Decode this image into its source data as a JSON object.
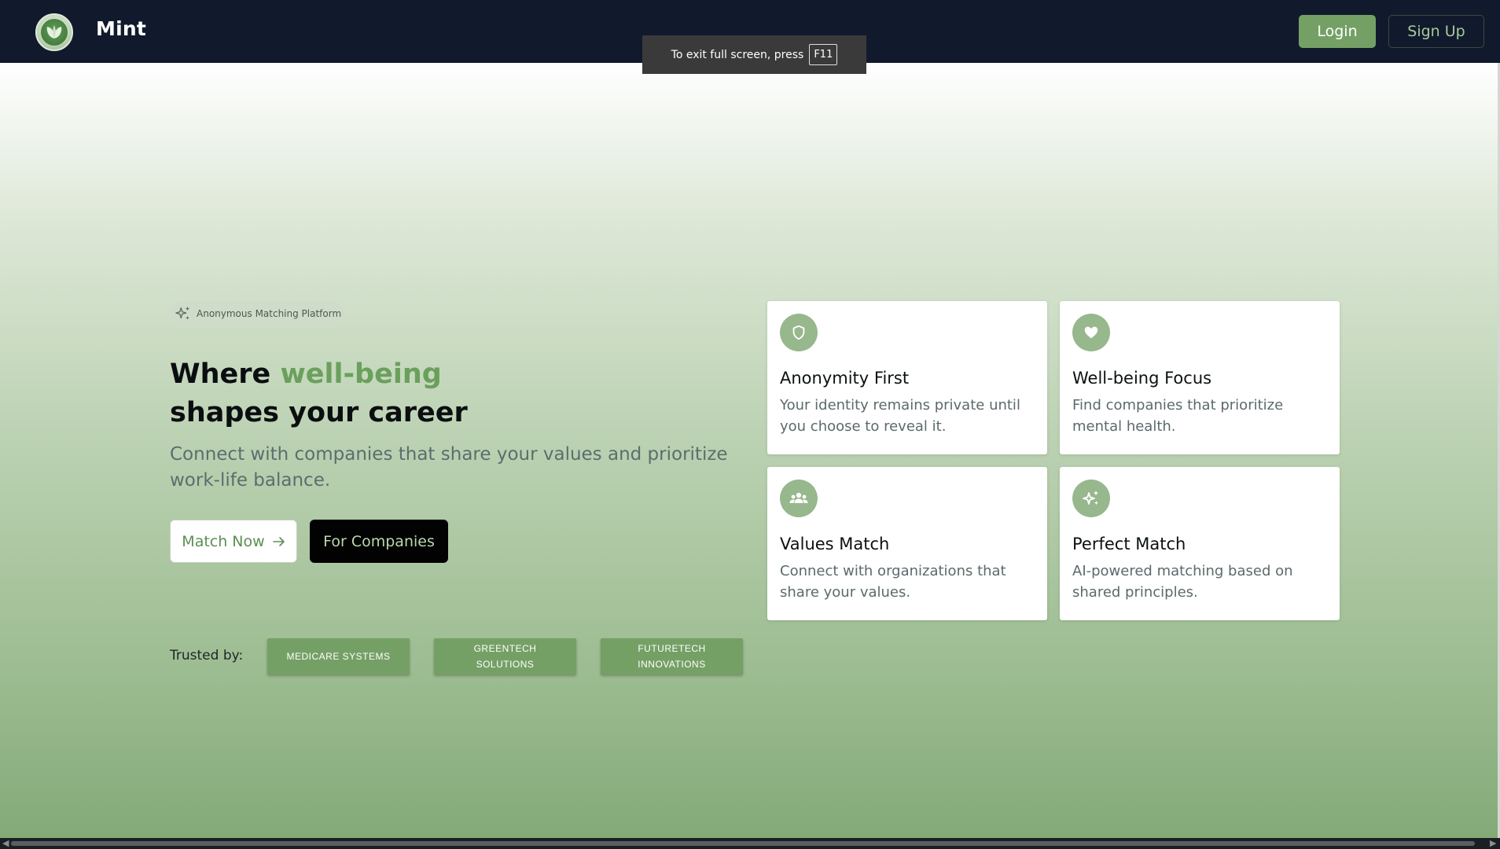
{
  "header": {
    "brand": "Mint",
    "login_label": "Login",
    "signup_label": "Sign Up"
  },
  "fullscreen_toast": {
    "text": "To exit full screen, press",
    "key": "F11"
  },
  "hero": {
    "badge": "Anonymous Matching Platform",
    "headline_prefix": "Where ",
    "headline_accent": "well-being",
    "headline_line2": "shapes your career",
    "subtext": "Connect with companies that share your values and prioritize work-life balance.",
    "match_label": "Match Now",
    "companies_label": "For Companies",
    "trusted_label": "Trusted by:",
    "trusted": [
      "MEDICARE SYSTEMS",
      "GREENTECH SOLUTIONS",
      "FUTURETECH INNOVATIONS"
    ]
  },
  "features": [
    {
      "icon": "shield-icon",
      "title": "Anonymity First",
      "desc": "Your identity remains private until you choose to reveal it."
    },
    {
      "icon": "heart-icon",
      "title": "Well-being Focus",
      "desc": "Find companies that prioritize mental health."
    },
    {
      "icon": "group-icon",
      "title": "Values Match",
      "desc": "Connect with organizations that share your values."
    },
    {
      "icon": "sparkles-icon",
      "title": "Perfect Match",
      "desc": "AI-powered matching based on shared principles."
    }
  ],
  "colors": {
    "nav_bg": "#111a2c",
    "accent": "#74a065",
    "accent_text": "#6aa05c"
  }
}
